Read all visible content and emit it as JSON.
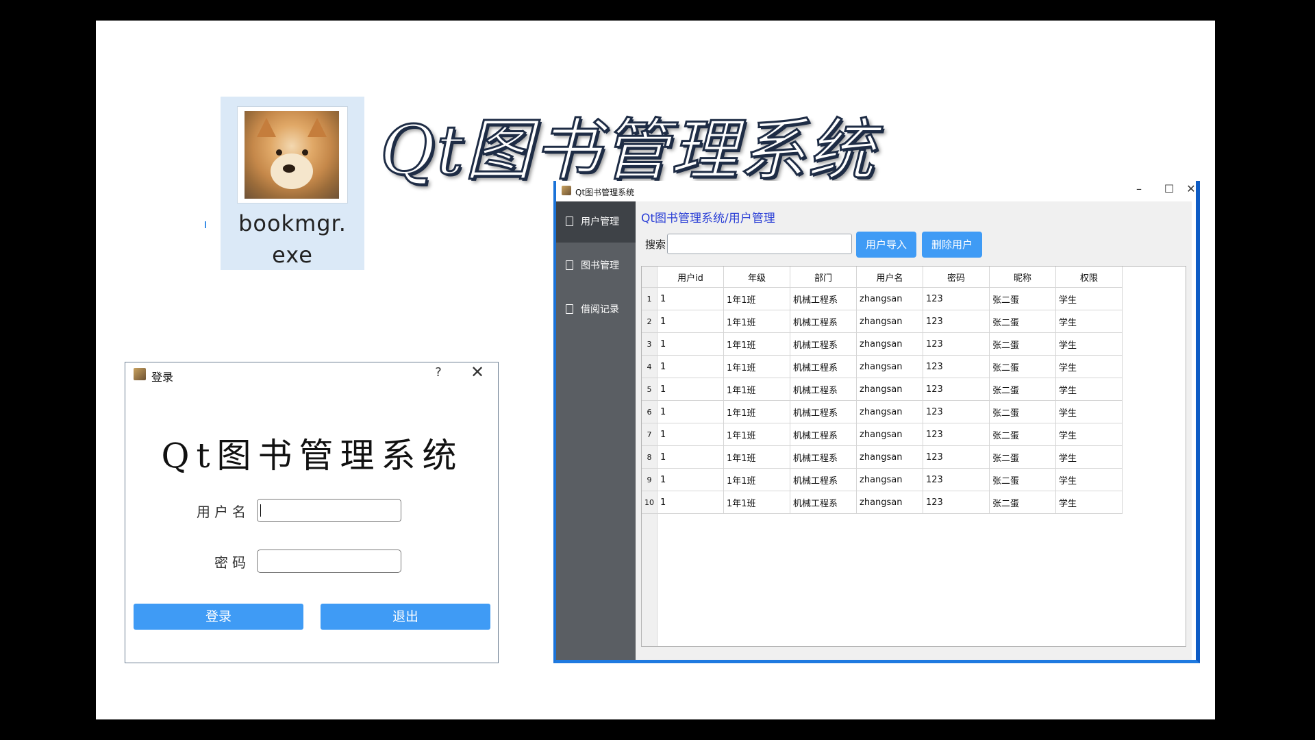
{
  "desktop_icon": {
    "label": "bookmgr.\nexe",
    "icon": "doge-photo-icon"
  },
  "heading": "Qt图书管理系统",
  "login_dialog": {
    "title": "登录",
    "help": "?",
    "close": "✕",
    "app_title": "Qt图书管理系统",
    "username_label": "用户名",
    "password_label": "密码",
    "username_value": "",
    "password_value": "",
    "login_button": "登录",
    "exit_button": "退出"
  },
  "main_window": {
    "title": "Qt图书管理系统",
    "minimize": "–",
    "maximize": "☐",
    "close": "✕",
    "sidebar": [
      {
        "label": "用户管理"
      },
      {
        "label": "图书管理"
      },
      {
        "label": "借阅记录"
      }
    ],
    "breadcrumb": "Qt图书管理系统/用户管理",
    "search_label": "搜索",
    "search_value": "",
    "import_button": "用户导入",
    "delete_button": "删除用户",
    "table": {
      "headers": [
        "用户id",
        "年级",
        "部门",
        "用户名",
        "密码",
        "昵称",
        "权限"
      ],
      "rows": [
        [
          "1",
          "1",
          "1年1班",
          "机械工程系",
          "zhangsan",
          "123",
          "张二蛋",
          "学生"
        ],
        [
          "2",
          "1",
          "1年1班",
          "机械工程系",
          "zhangsan",
          "123",
          "张二蛋",
          "学生"
        ],
        [
          "3",
          "1",
          "1年1班",
          "机械工程系",
          "zhangsan",
          "123",
          "张二蛋",
          "学生"
        ],
        [
          "4",
          "1",
          "1年1班",
          "机械工程系",
          "zhangsan",
          "123",
          "张二蛋",
          "学生"
        ],
        [
          "5",
          "1",
          "1年1班",
          "机械工程系",
          "zhangsan",
          "123",
          "张二蛋",
          "学生"
        ],
        [
          "6",
          "1",
          "1年1班",
          "机械工程系",
          "zhangsan",
          "123",
          "张二蛋",
          "学生"
        ],
        [
          "7",
          "1",
          "1年1班",
          "机械工程系",
          "zhangsan",
          "123",
          "张二蛋",
          "学生"
        ],
        [
          "8",
          "1",
          "1年1班",
          "机械工程系",
          "zhangsan",
          "123",
          "张二蛋",
          "学生"
        ],
        [
          "9",
          "1",
          "1年1班",
          "机械工程系",
          "zhangsan",
          "123",
          "张二蛋",
          "学生"
        ],
        [
          "10",
          "1",
          "1年1班",
          "机械工程系",
          "zhangsan",
          "123",
          "张二蛋",
          "学生"
        ]
      ]
    }
  },
  "colors": {
    "accent": "#3f9bf5",
    "sidebar": "#5a5e63",
    "sidebar_active": "#3e4247",
    "breadcrumb": "#2b3fd6",
    "window_border": "#1b73d8"
  }
}
